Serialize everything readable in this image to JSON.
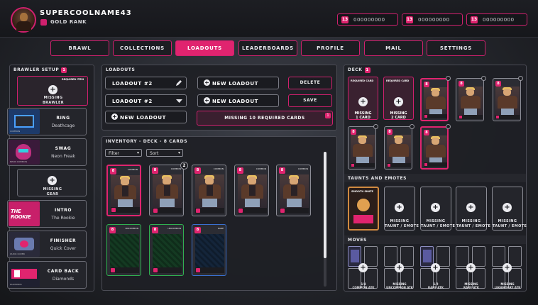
{
  "user": {
    "name": "SUPERCOOLNAME43",
    "rank": "GOLD RANK"
  },
  "currencies": [
    {
      "icon": "13",
      "value": "000000000"
    },
    {
      "icon": "13",
      "value": "000000000"
    },
    {
      "icon": "13",
      "value": "000000000"
    }
  ],
  "nav_tabs": [
    {
      "label": "BRAWL"
    },
    {
      "label": "COLLECTIONS"
    },
    {
      "label": "LOADOUTS",
      "active": true
    },
    {
      "label": "LEADERBOARDS"
    },
    {
      "label": "PROFILE"
    },
    {
      "label": "MAIL"
    },
    {
      "label": "SETTINGS"
    }
  ],
  "brawler_setup": {
    "title": "BRAWLER SETUP",
    "badge": "1",
    "required_item_label": "REQUIRED ITEM",
    "missing_brawler": "MISSING\nBRAWLER",
    "slots": [
      {
        "name": "RING",
        "value": "Deathcage",
        "tag": "COMMON"
      },
      {
        "name": "SWAG",
        "value": "Neon Freak",
        "tag": "NEON COMMON"
      },
      {
        "name": "MISSING\nGEAR",
        "value": ""
      },
      {
        "name": "INTRO",
        "value": "The Rookie",
        "tag": "THE ROOKIE"
      },
      {
        "name": "FINISHER",
        "value": "Quick Cover",
        "tag": "QUICK COVER"
      },
      {
        "name": "CARD BACK",
        "value": "Diamonds",
        "tag": "DIAMONDS"
      }
    ]
  },
  "loadouts": {
    "title": "LOADOUTS",
    "fields": [
      "LOADOUT #2",
      "LOADOUT #2"
    ],
    "new_loadout": "NEW LOADOUT",
    "new_loadout_buttons": [
      "NEW LOADOUT",
      "NEW LOADOUT"
    ],
    "delete_label": "DELETE",
    "save_label": "SAVE",
    "warning": "MISSING 10 REQUIRED CARDS",
    "warning_badge": "1"
  },
  "inventory": {
    "title": "INVENTORY - DECK - 8 CARDS",
    "filter": "Filter",
    "sort": "Sort",
    "count_badge": "2",
    "cards": [
      {
        "level": "8",
        "type": "COMMON",
        "style": "pink",
        "selected": true
      },
      {
        "level": "8",
        "type": "COMMON",
        "style": "pink"
      },
      {
        "level": "8",
        "type": "COMMON",
        "style": "pink"
      },
      {
        "level": "8",
        "type": "COMMON",
        "style": "pink"
      },
      {
        "level": "8",
        "type": "COMMON",
        "style": "pink"
      },
      {
        "level": "8",
        "type": "UNCOMMON",
        "style": "green"
      },
      {
        "level": "8",
        "type": "UNCOMMON",
        "style": "green"
      },
      {
        "level": "8",
        "type": "RARE",
        "style": "blue"
      }
    ]
  },
  "deck": {
    "title": "DECK",
    "badge": "1",
    "required": [
      {
        "title": "REQUIRED CARD",
        "missing": "MISSING\n1 CARD"
      },
      {
        "title": "REQUIRED CARD",
        "missing": "MISSING\n2 CARD"
      }
    ],
    "cards": [
      "8",
      "8",
      "8",
      "8",
      "8",
      "8",
      "8"
    ]
  },
  "taunts": {
    "title": "TAUNTS AND EMOTES",
    "card_label": "SMOOTH SKATE",
    "missing_label": "MISSING\nTAUNT / EMOTE"
  },
  "moves": {
    "title": "MOVES",
    "slots": [
      {
        "label": "1/4\nCOMMON ATK"
      },
      {
        "label": "MISSING\nUNCOMMON ATK"
      },
      {
        "label": "1/2\nRARE ATK"
      },
      {
        "label": "MISSING\nRARE ATK"
      },
      {
        "label": "MISSING\nLEGENDARY ATK"
      }
    ]
  }
}
